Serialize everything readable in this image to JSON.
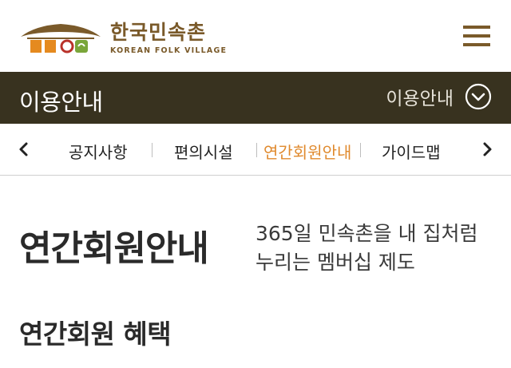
{
  "header": {
    "logo_ko": "한국민속촌",
    "logo_en": "KOREAN FOLK VILLAGE",
    "colors": {
      "brand_brown": "#7a5a2a",
      "accent_orange": "#e58a1f",
      "accent_green": "#7aa63a"
    }
  },
  "titlebar": {
    "title": "이용안내",
    "dropdown_label": "이용안내",
    "background": "#38321f"
  },
  "tabs": [
    {
      "label": "공지사항",
      "active": false
    },
    {
      "label": "편의시설",
      "active": false
    },
    {
      "label": "연간회원안내",
      "active": true
    },
    {
      "label": "가이드맵",
      "active": false
    }
  ],
  "main": {
    "title": "연간회원안내",
    "description_line1": "365일 민속촌을 내 집처럼",
    "description_line2": "누리는 멤버십 제도",
    "section_title": "연간회원 혜택"
  }
}
